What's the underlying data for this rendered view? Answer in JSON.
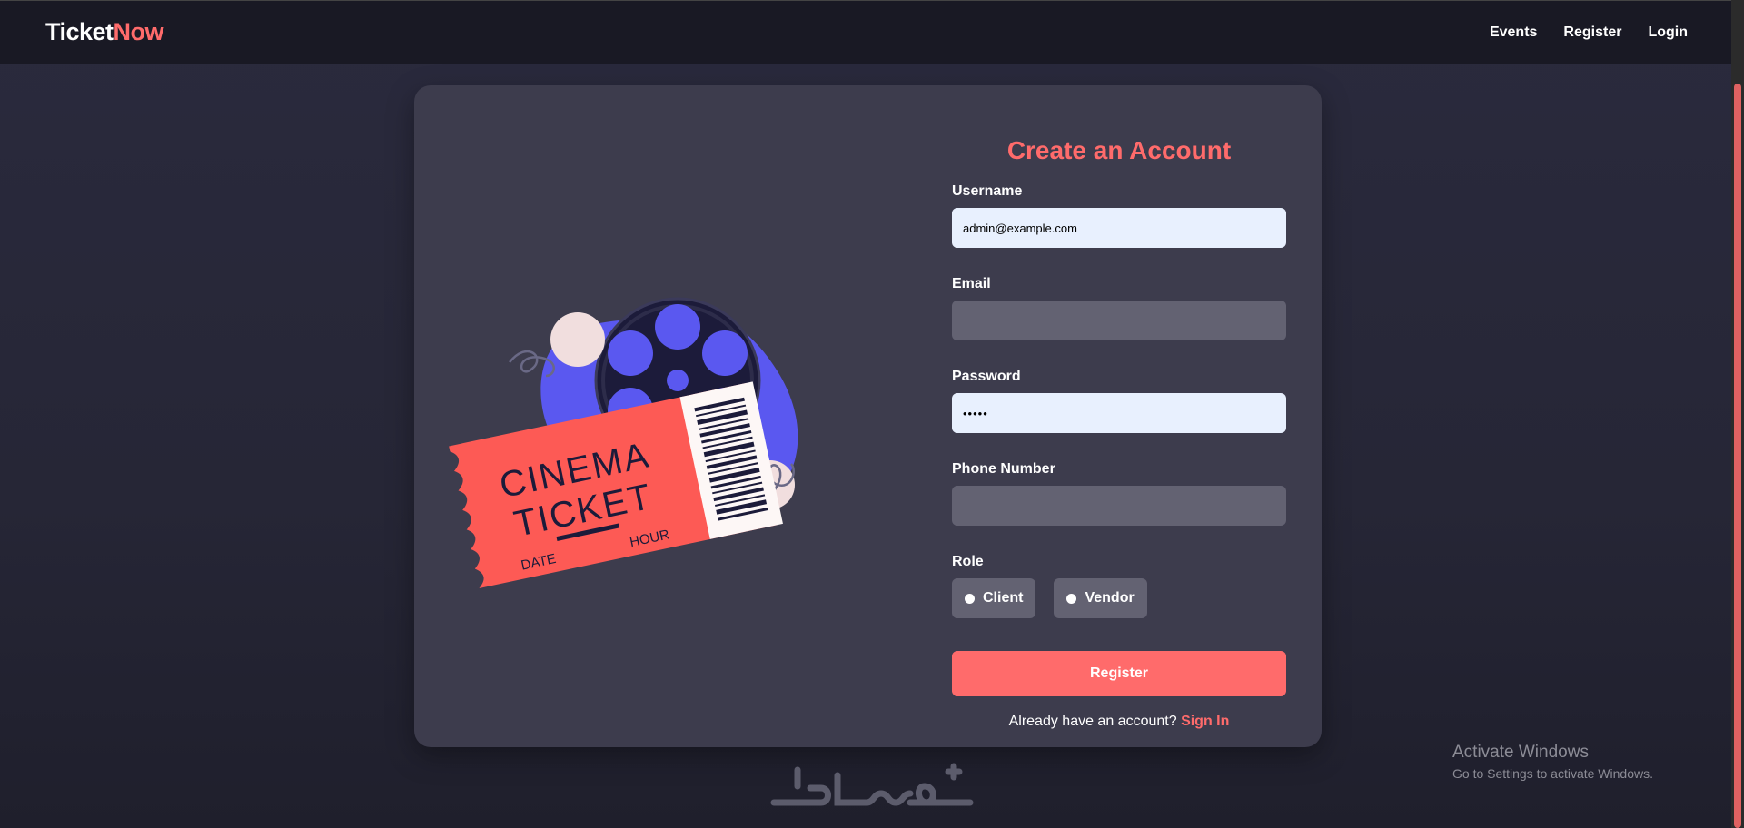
{
  "nav": {
    "brand_part1": "Ticket",
    "brand_part2": "Now",
    "links": [
      "Events",
      "Register",
      "Login"
    ]
  },
  "illustration": {
    "ticket_line1": "CINEMA",
    "ticket_line2": "TICKET",
    "ticket_date": "DATE",
    "ticket_hour": "HOUR"
  },
  "form": {
    "title": "Create an Account",
    "username_label": "Username",
    "username_value": "admin@example.com",
    "email_label": "Email",
    "email_value": "",
    "password_label": "Password",
    "password_value": "•••••",
    "phone_label": "Phone Number",
    "phone_value": "",
    "role_label": "Role",
    "roles": [
      "Client",
      "Vendor"
    ],
    "submit_label": "Register",
    "signin_prompt": "Already have an account?",
    "signin_link": "Sign In"
  },
  "system": {
    "activate_title": "Activate Windows",
    "activate_subtitle": "Go to Settings to activate Windows."
  },
  "colors": {
    "accent": "#ff6b6b",
    "background": "#262636",
    "card": "#3d3c4d",
    "input_filled": "#e8f0fe",
    "input_empty": "#636272"
  }
}
